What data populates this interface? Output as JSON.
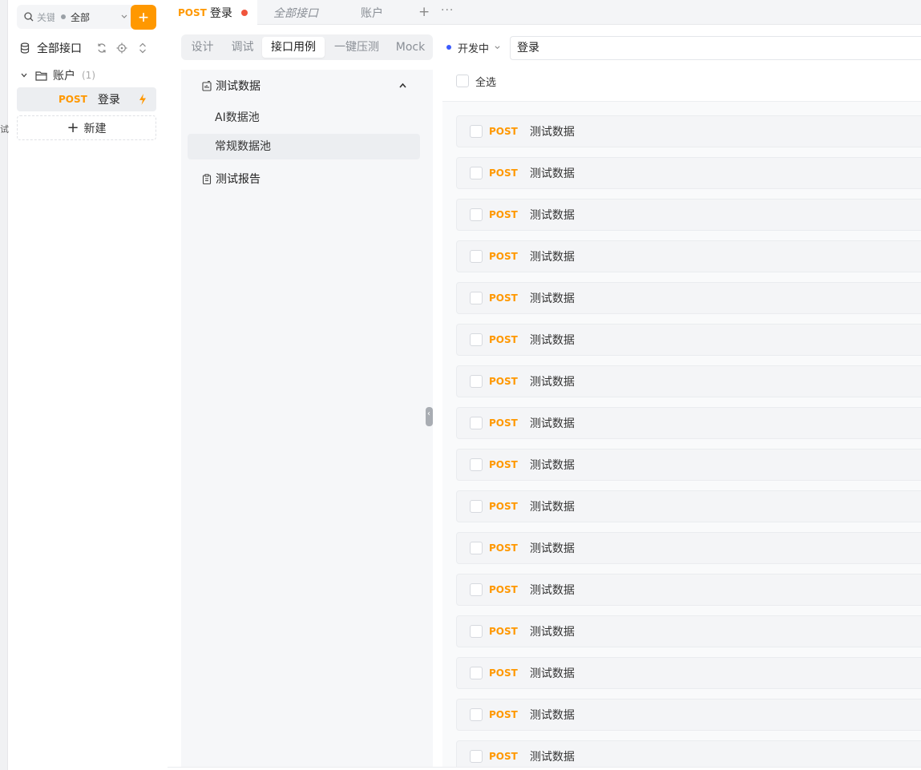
{
  "edge": {
    "glyph": "试"
  },
  "sidebar": {
    "search_placeholder": "关键字",
    "filter_label": "全部",
    "add_label": "+",
    "root_label": "全部接口",
    "folder": {
      "label": "账户",
      "count": "(1)"
    },
    "api_item": {
      "method": "POST",
      "name": "登录"
    },
    "new_label": "新建",
    "new_plus": "+"
  },
  "tabs": [
    {
      "method": "POST",
      "title": "登录"
    },
    {
      "title": "全部接口"
    },
    {
      "title": "账户"
    }
  ],
  "tab_add": "+",
  "tab_more": "···",
  "subtabs": [
    "设计",
    "调试",
    "接口用例",
    "一键压测",
    "Mock"
  ],
  "status": {
    "label": "开发中",
    "color": "#3b5bfd"
  },
  "api_name": "登录",
  "tree": {
    "test_data": "测试数据",
    "pools": [
      "AI数据池",
      "常规数据池"
    ],
    "test_report": "测试报告"
  },
  "select_all_label": "全选",
  "rows": [
    {
      "method": "POST",
      "name": "测试数据"
    },
    {
      "method": "POST",
      "name": "测试数据"
    },
    {
      "method": "POST",
      "name": "测试数据"
    },
    {
      "method": "POST",
      "name": "测试数据"
    },
    {
      "method": "POST",
      "name": "测试数据"
    },
    {
      "method": "POST",
      "name": "测试数据"
    },
    {
      "method": "POST",
      "name": "测试数据"
    },
    {
      "method": "POST",
      "name": "测试数据"
    },
    {
      "method": "POST",
      "name": "测试数据"
    },
    {
      "method": "POST",
      "name": "测试数据"
    },
    {
      "method": "POST",
      "name": "测试数据"
    },
    {
      "method": "POST",
      "name": "测试数据"
    },
    {
      "method": "POST",
      "name": "测试数据"
    },
    {
      "method": "POST",
      "name": "测试数据"
    },
    {
      "method": "POST",
      "name": "测试数据"
    },
    {
      "method": "POST",
      "name": "测试数据"
    }
  ],
  "colors": {
    "accent": "#ff9800",
    "unsaved_dot": "#f0553c"
  }
}
